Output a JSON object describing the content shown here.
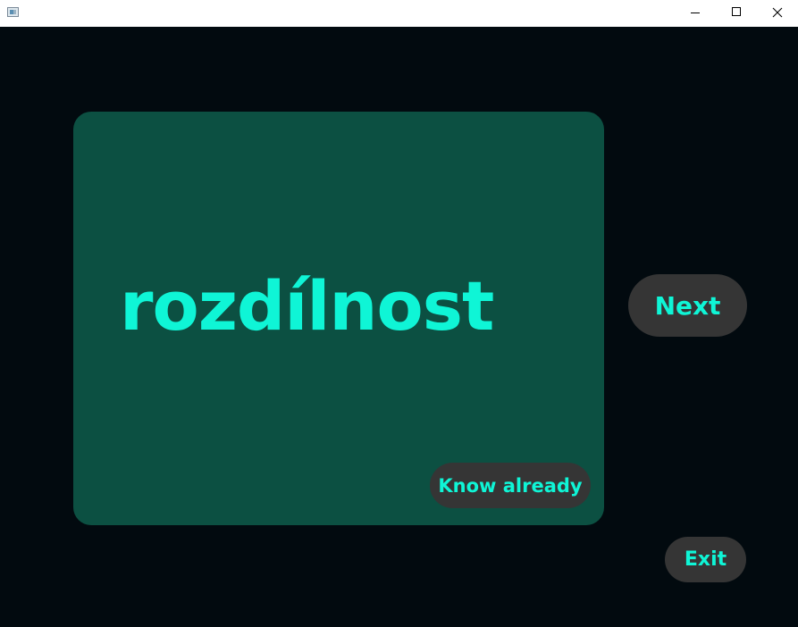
{
  "window": {
    "icon": "app-window-icon",
    "controls": {
      "minimize": "minimize-icon",
      "maximize": "maximize-icon",
      "close": "close-icon"
    }
  },
  "card": {
    "word": "rozdílnost",
    "know_label": "Know already"
  },
  "actions": {
    "next_label": "Next",
    "exit_label": "Exit"
  },
  "colors": {
    "background": "#020a0f",
    "card": "#0c5042",
    "accent_text": "#0ff5d6",
    "button": "#353535"
  }
}
